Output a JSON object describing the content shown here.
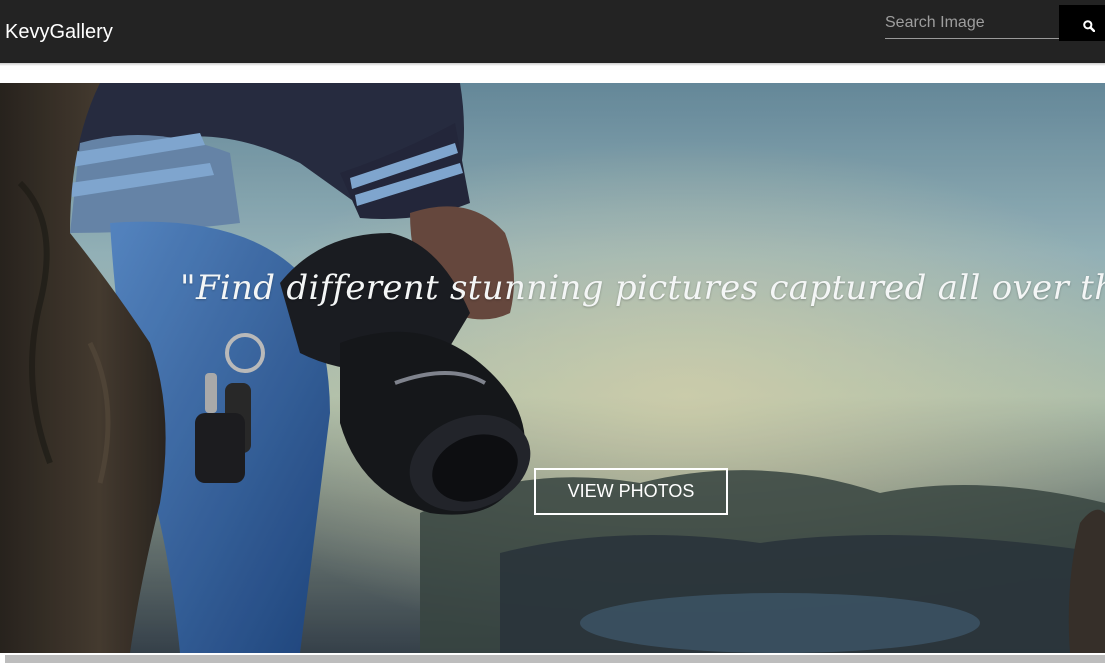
{
  "navbar": {
    "brand": "KevyGallery",
    "search": {
      "placeholder": "Search Image",
      "value": ""
    }
  },
  "hero": {
    "quote": "\"Find different stunning pictures captured all over the world\"",
    "cta_label": "VIEW PHOTOS"
  },
  "icons": {
    "search_button_icon": "search-icon"
  },
  "colors": {
    "navbar_bg": "#232323",
    "search_button_bg": "#000000",
    "text_light": "#ffffff"
  }
}
